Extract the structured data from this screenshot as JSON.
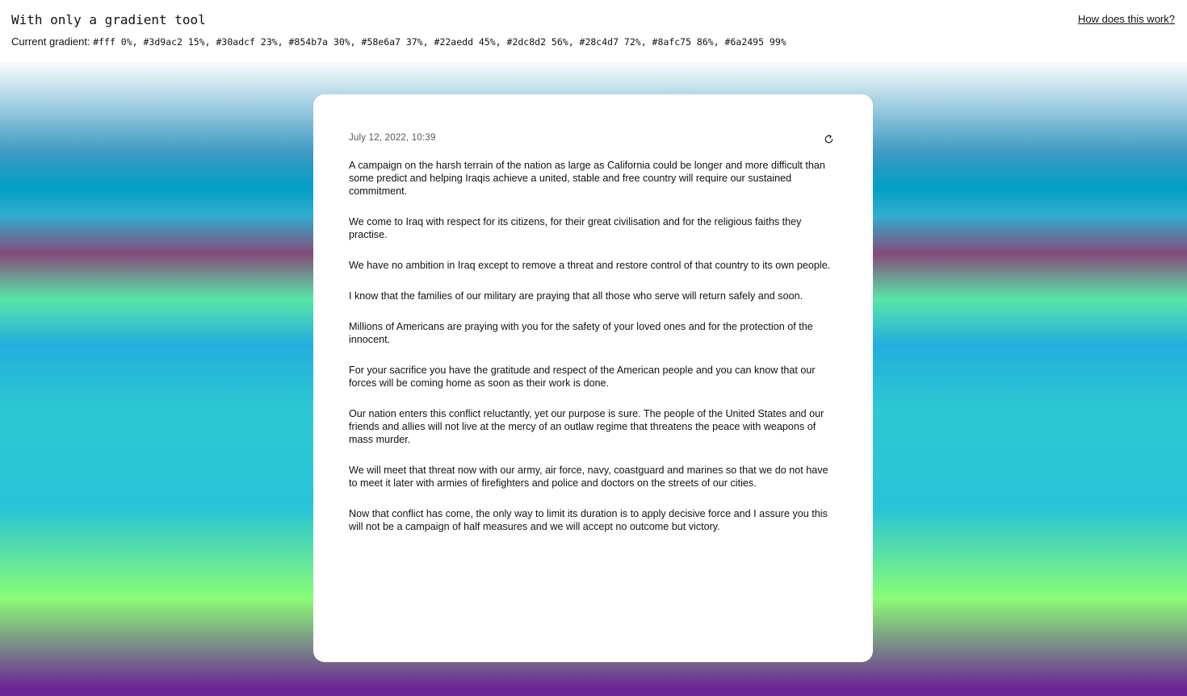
{
  "header": {
    "title": "With only a gradient tool",
    "gradient_label": "Current gradient:",
    "gradient_value": "#fff 0%, #3d9ac2 15%, #30adcf 23%, #854b7a 30%, #58e6a7 37%, #22aedd 45%, #2dc8d2 56%, #28c4d7 72%, #8afc75 86%, #6a2495 99%",
    "help_link": "How does this work?"
  },
  "card": {
    "timestamp": "July 12, 2022, 10:39",
    "refresh_icon": "refresh-icon",
    "paragraphs": [
      "A campaign on the harsh terrain of the nation as large as California could be longer and more difficult than some predict and helping Iraqis achieve a united, stable and free country will require our sustained commitment.",
      "We come to Iraq with respect for its citizens, for their great civilisation and for the religious faiths they practise.",
      "We have no ambition in Iraq except to remove a threat and restore control of that country to its own people.",
      "I know that the families of our military are praying that all those who serve will return safely and soon.",
      "Millions of Americans are praying with you for the safety of your loved ones and for the protection of the innocent.",
      "For your sacrifice you have the gratitude and respect of the American people and you can know that our forces will be coming home as soon as their work is done.",
      "Our nation enters this conflict reluctantly, yet our purpose is sure. The people of the United States and our friends and allies will not live at the mercy of an outlaw regime that threatens the peace with weapons of mass murder.",
      "We will meet that threat now with our army, air force, navy, coastguard and marines so that we do not have to meet it later with armies of firefighters and police and doctors on the streets of our cities.",
      "Now that conflict has come, the only way to limit its duration is to apply decisive force and I assure you this will not be a campaign of half measures and we will accept no outcome but victory."
    ]
  }
}
